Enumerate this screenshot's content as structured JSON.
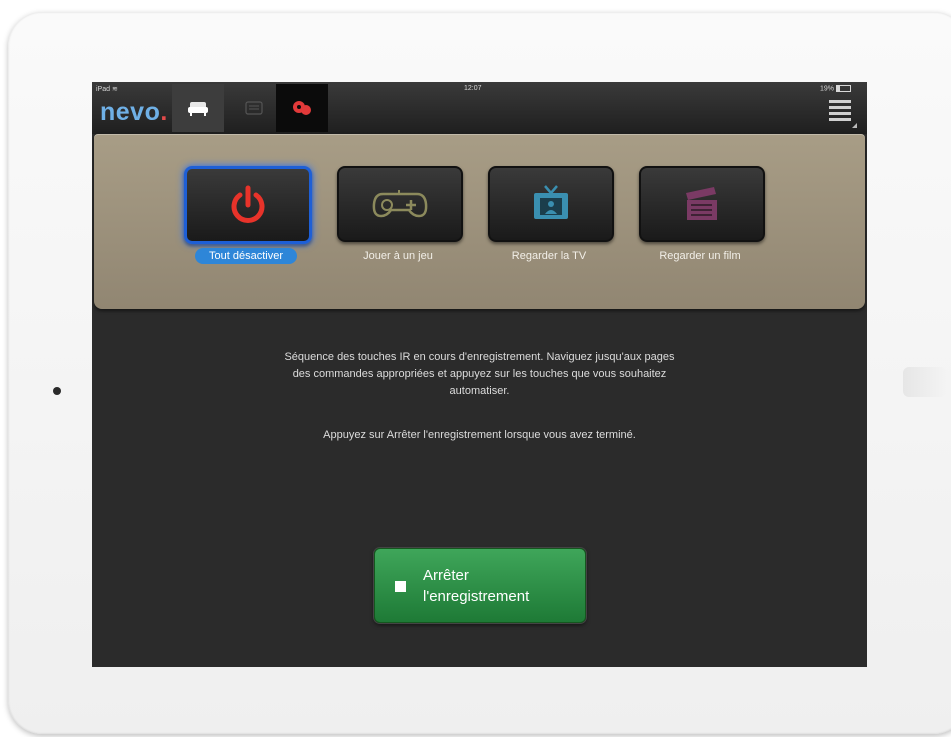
{
  "status_bar": {
    "device": "iPad",
    "time": "12:07",
    "battery": "19%"
  },
  "header": {
    "logo_text": "nevo",
    "logo_dot": ".",
    "tabs": [
      {
        "icon": "sofa-icon",
        "active": true
      },
      {
        "icon": "remote-icon",
        "active": false
      },
      {
        "icon": "macro-icon",
        "active": false
      }
    ],
    "menu_icon": "list-menu-icon"
  },
  "activities": [
    {
      "label": "Tout désactiver",
      "icon": "power-icon",
      "selected": true,
      "icon_color": "#e8332a"
    },
    {
      "label": "Jouer à un jeu",
      "icon": "gamepad-icon",
      "selected": false,
      "icon_color": "#8c8a5c"
    },
    {
      "label": "Regarder la TV",
      "icon": "tv-icon",
      "selected": false,
      "icon_color": "#3a8fb0"
    },
    {
      "label": "Regarder un film",
      "icon": "clapperboard-icon",
      "selected": false,
      "icon_color": "#7a3a64"
    }
  ],
  "message": {
    "line1": "Séquence des touches IR en cours d'enregistrement. Naviguez jusqu'aux pages",
    "line2": "des commandes appropriées et appuyez sur les touches que vous souhaitez",
    "line3": "automatiser.",
    "line4": "Appuyez sur Arrêter l'enregistrement lorsque vous avez terminé."
  },
  "stop_button": {
    "line1": "Arrêter",
    "line2": "l'enregistrement",
    "icon": "stop-square-icon"
  },
  "colors": {
    "accent_blue": "#2e86d8",
    "record_green": "#2e9247",
    "panel": "#a0957e"
  }
}
